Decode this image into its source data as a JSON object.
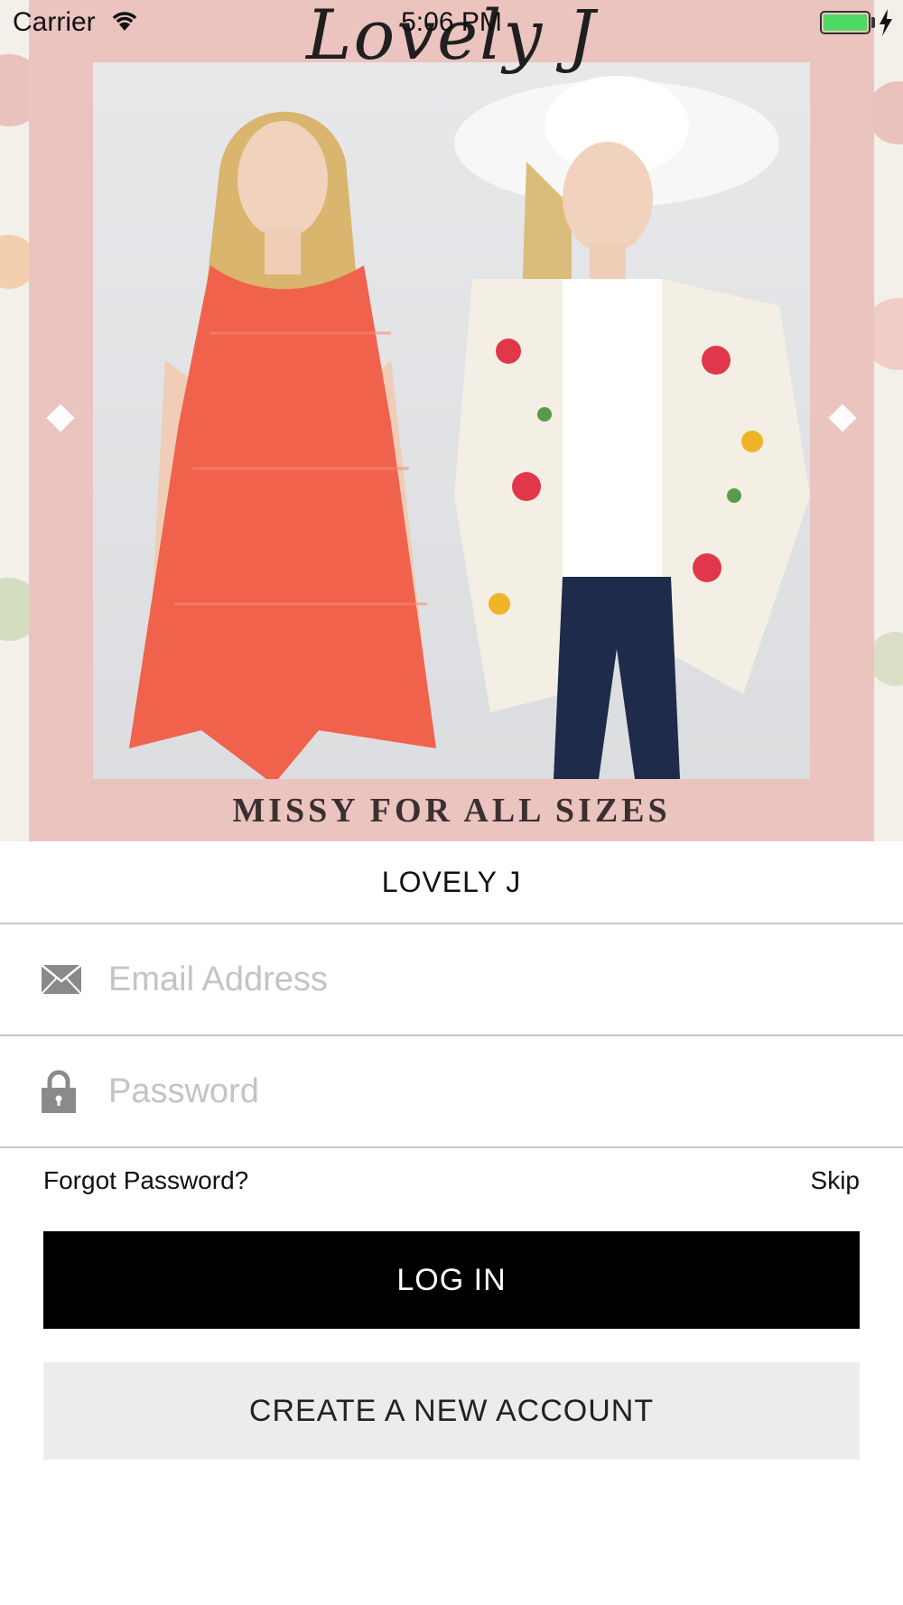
{
  "status_bar": {
    "carrier": "Carrier",
    "time": "5:06 PM",
    "wifi_icon": "wifi-icon",
    "battery_icon": "battery-icon",
    "battery_level": 1.0,
    "battery_color": "#4cd964"
  },
  "banner": {
    "logo_text": "Lovely J",
    "tagline": "MISSY FOR ALL SIZES",
    "frame_color": "#ebc3bf",
    "prev_icon": "diamond-prev-icon",
    "next_icon": "diamond-next-icon"
  },
  "store": {
    "title": "LOVELY J"
  },
  "form": {
    "email_icon": "envelope-icon",
    "email_placeholder": "Email Address",
    "email_value": "",
    "password_icon": "lock-icon",
    "password_placeholder": "Password",
    "password_value": "",
    "forgot_label": "Forgot Password?",
    "skip_label": "Skip"
  },
  "actions": {
    "login_label": "LOG IN",
    "create_label": "CREATE A NEW ACCOUNT",
    "login_bg": "#000000",
    "create_bg": "#ececec"
  }
}
